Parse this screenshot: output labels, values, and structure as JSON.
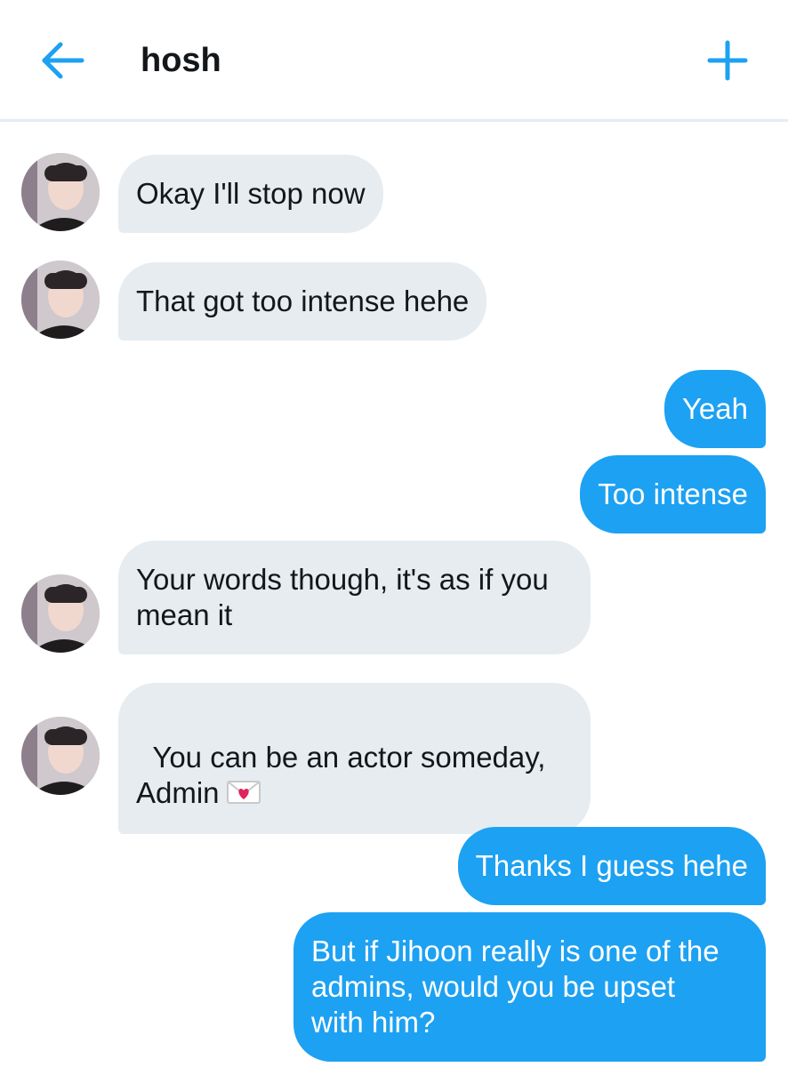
{
  "header": {
    "title": "hosh",
    "back_icon": "arrow-left-icon",
    "add_icon": "plus-icon",
    "accent_color": "#1da1f2"
  },
  "messages": [
    {
      "direction": "received",
      "text": "Okay I'll stop now"
    },
    {
      "direction": "received",
      "text": "That got too intense hehe"
    },
    {
      "direction": "sent",
      "text": "Yeah"
    },
    {
      "direction": "sent",
      "text": "Too intense"
    },
    {
      "direction": "received",
      "text": "Your words though, it's as if you\nmean it"
    },
    {
      "direction": "received",
      "text": "You can be an actor someday,\nAdmin",
      "emoji": "love-letter-icon"
    },
    {
      "direction": "sent",
      "text": "Thanks I guess hehe"
    },
    {
      "direction": "sent",
      "text": "But if Jihoon really is one of the\nadmins, would you be upset\nwith him?"
    }
  ],
  "colors": {
    "received_bubble": "#e6ecf0",
    "sent_bubble": "#1da1f2",
    "divider": "#e6ecf0"
  }
}
